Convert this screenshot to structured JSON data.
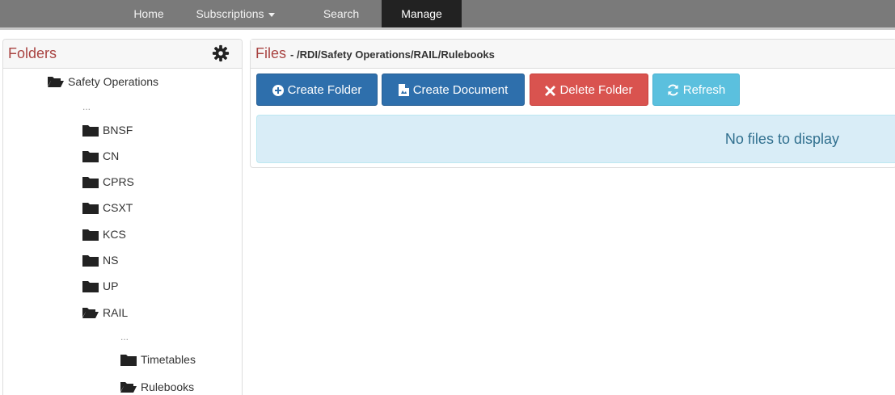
{
  "nav": {
    "home": "Home",
    "subscriptions": "Subscriptions",
    "search": "Search",
    "manage": "Manage",
    "active": "Manage"
  },
  "folders": {
    "title": "Folders",
    "settings_icon": "gear-icon",
    "tree": [
      {
        "label": "Safety Operations",
        "icon": "folder-open-icon"
      },
      {
        "label": "...",
        "icon": ""
      },
      {
        "label": "BNSF",
        "icon": "folder-icon"
      },
      {
        "label": "CN",
        "icon": "folder-icon"
      },
      {
        "label": "CPRS",
        "icon": "folder-icon"
      },
      {
        "label": "CSXT",
        "icon": "folder-icon"
      },
      {
        "label": "KCS",
        "icon": "folder-icon"
      },
      {
        "label": "NS",
        "icon": "folder-icon"
      },
      {
        "label": "UP",
        "icon": "folder-icon"
      },
      {
        "label": "RAIL",
        "icon": "folder-open-icon"
      },
      {
        "label": "...",
        "icon": ""
      },
      {
        "label": "Timetables",
        "icon": "folder-icon"
      },
      {
        "label": "Rulebooks",
        "icon": "folder-open-icon"
      }
    ]
  },
  "files": {
    "title": "Files",
    "path": "- /RDI/Safety Operations/RAIL/Rulebooks",
    "buttons": {
      "create_folder": "Create Folder",
      "create_document": "Create Document",
      "delete_folder": "Delete Folder",
      "refresh": "Refresh"
    },
    "empty_message": "No files to display"
  },
  "colors": {
    "nav_bg": "#7a7a7a",
    "nav_active": "#222222",
    "panel_title": "#a94442",
    "primary": "#2e6fac",
    "danger": "#d9534f",
    "info": "#5bc0de",
    "alert_bg": "#d9edf7"
  }
}
